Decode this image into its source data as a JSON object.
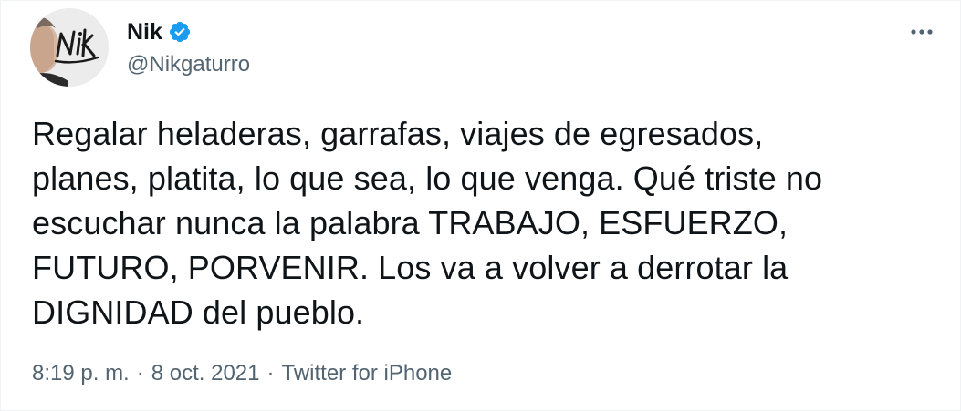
{
  "user": {
    "display_name": "Nik",
    "handle": "@Nikgaturro",
    "verified": true,
    "avatar_signature": "Nik"
  },
  "tweet": {
    "text": "Regalar heladeras, garrafas, viajes de egresados,\nplanes, platita, lo que sea, lo que venga. Qué triste no\nescuchar nunca la palabra TRABAJO, ESFUERZO,\nFUTURO, PORVENIR. Los va a volver a derrotar la\nDIGNIDAD del pueblo.",
    "time": "8:19 p. m.",
    "separator": "·",
    "date": "8 oct. 2021",
    "source": "Twitter for iPhone"
  },
  "icons": {
    "verified": "verified-badge-icon",
    "more": "more-horizontal-icon"
  },
  "colors": {
    "verified_blue": "#1d9bf0",
    "text_primary": "#0f1419",
    "text_secondary": "#536471"
  }
}
